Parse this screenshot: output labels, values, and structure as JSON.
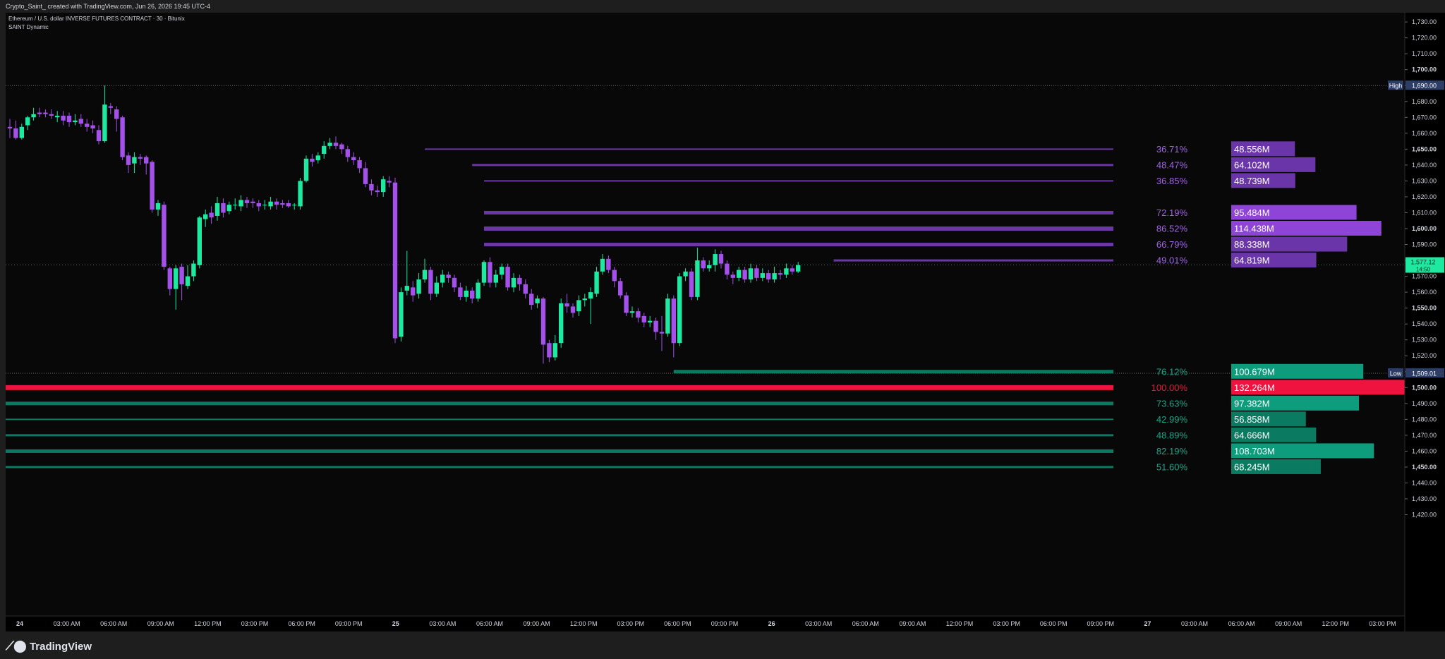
{
  "header": {
    "credit": "Crypto_Saint_ created with TradingView.com, Jun 26, 2026 19:45 UTC-4"
  },
  "legend": {
    "symbol": "Ethereum / U.S. dollar INVERSE FUTURES CONTRACT · 30 · Bitunix",
    "indicator": "SAINT Dynamic"
  },
  "footer": {
    "brand": "TradingView"
  },
  "chart_data": {
    "type": "candlestick",
    "y_range": [
      1410,
      1770
    ],
    "y_ticks": [
      1420,
      1430,
      1440,
      1450,
      1460,
      1470,
      1480,
      1490,
      1500,
      1510,
      1520,
      1530,
      1540,
      1550,
      1560,
      1570,
      1580,
      1590,
      1600,
      1610,
      1620,
      1630,
      1640,
      1650,
      1660,
      1670,
      1680,
      1690,
      1700,
      1710,
      1720,
      1730,
      1740,
      1750,
      1760
    ],
    "major_ticks": [
      1450,
      1500,
      1550,
      1600,
      1650,
      1700,
      1750
    ],
    "x_labels": [
      "24",
      "03:00 AM",
      "06:00 AM",
      "09:00 AM",
      "12:00 PM",
      "03:00 PM",
      "06:00 PM",
      "09:00 PM",
      "25",
      "03:00 AM",
      "06:00 AM",
      "09:00 AM",
      "12:00 PM",
      "03:00 PM",
      "06:00 PM",
      "09:00 PM",
      "26",
      "03:00 AM",
      "06:00 AM",
      "09:00 AM",
      "12:00 PM",
      "03:00 PM",
      "06:00 PM",
      "09:00 PM",
      "27",
      "03:00 AM",
      "06:00 AM",
      "09:00 AM",
      "12:00 PM",
      "03:00 PM"
    ],
    "x_label_bold": [
      "24",
      "25",
      "26",
      "27"
    ],
    "colors": {
      "up": "#1de9a0",
      "down": "#a451ec",
      "high_low_line": "#6a6a6a"
    },
    "candles": [
      [
        1664,
        1663,
        1669,
        1657
      ],
      [
        1663,
        1657,
        1668,
        1656
      ],
      [
        1657,
        1664,
        1666,
        1656
      ],
      [
        1665,
        1670,
        1671,
        1662
      ],
      [
        1670,
        1672,
        1676,
        1668
      ],
      [
        1673,
        1672,
        1676,
        1670
      ],
      [
        1673,
        1672,
        1675,
        1670
      ],
      [
        1672,
        1671,
        1675,
        1669
      ],
      [
        1670,
        1671,
        1674,
        1667
      ],
      [
        1671,
        1668,
        1674,
        1665
      ],
      [
        1671,
        1667,
        1673,
        1664
      ],
      [
        1667,
        1668,
        1672,
        1665
      ],
      [
        1669,
        1666,
        1672,
        1664
      ],
      [
        1666,
        1664,
        1669,
        1661
      ],
      [
        1665,
        1663,
        1668,
        1660
      ],
      [
        1662,
        1655,
        1665,
        1653
      ],
      [
        1655,
        1678,
        1690,
        1654
      ],
      [
        1677,
        1676,
        1679,
        1672
      ],
      [
        1675,
        1669,
        1677,
        1661
      ],
      [
        1670,
        1645,
        1671,
        1643
      ],
      [
        1646,
        1640,
        1648,
        1635
      ],
      [
        1641,
        1645,
        1648,
        1635
      ],
      [
        1645,
        1644,
        1647,
        1640
      ],
      [
        1645,
        1641,
        1646,
        1634
      ],
      [
        1642,
        1612,
        1643,
        1610
      ],
      [
        1612,
        1616,
        1618,
        1608
      ],
      [
        1615,
        1576,
        1617,
        1574
      ],
      [
        1575,
        1562,
        1576,
        1558
      ],
      [
        1562,
        1575,
        1577,
        1549
      ],
      [
        1576,
        1565,
        1578,
        1555
      ],
      [
        1564,
        1570,
        1577,
        1562
      ],
      [
        1570,
        1578,
        1580,
        1567
      ],
      [
        1577,
        1607,
        1608,
        1575
      ],
      [
        1606,
        1609,
        1612,
        1601
      ],
      [
        1610,
        1607,
        1614,
        1603
      ],
      [
        1608,
        1616,
        1620,
        1605
      ],
      [
        1616,
        1610,
        1619,
        1607
      ],
      [
        1611,
        1615,
        1617,
        1609
      ],
      [
        1615,
        1615,
        1619,
        1612
      ],
      [
        1614,
        1618,
        1621,
        1611
      ],
      [
        1618,
        1616,
        1620,
        1613
      ],
      [
        1617,
        1616,
        1619,
        1613
      ],
      [
        1616,
        1614,
        1618,
        1611
      ],
      [
        1615,
        1615,
        1618,
        1612
      ],
      [
        1614,
        1617,
        1620,
        1612
      ],
      [
        1617,
        1615,
        1619,
        1612
      ],
      [
        1616,
        1615,
        1618,
        1613
      ],
      [
        1616,
        1614,
        1618,
        1613
      ],
      [
        1615,
        1615,
        1616,
        1612
      ],
      [
        1614,
        1630,
        1632,
        1612
      ],
      [
        1630,
        1644,
        1646,
        1629
      ],
      [
        1644,
        1642,
        1647,
        1639
      ],
      [
        1643,
        1646,
        1648,
        1641
      ],
      [
        1647,
        1652,
        1655,
        1644
      ],
      [
        1652,
        1654,
        1657,
        1650
      ],
      [
        1654,
        1652,
        1658,
        1650
      ],
      [
        1653,
        1650,
        1654,
        1647
      ],
      [
        1650,
        1645,
        1652,
        1642
      ],
      [
        1645,
        1643,
        1648,
        1640
      ],
      [
        1643,
        1638,
        1645,
        1635
      ],
      [
        1638,
        1628,
        1642,
        1626
      ],
      [
        1628,
        1624,
        1631,
        1621
      ],
      [
        1624,
        1623,
        1627,
        1620
      ],
      [
        1623,
        1631,
        1633,
        1620
      ],
      [
        1630,
        1629,
        1633,
        1626
      ],
      [
        1629,
        1531,
        1632,
        1528
      ],
      [
        1532,
        1560,
        1563,
        1529
      ],
      [
        1561,
        1564,
        1586,
        1558
      ],
      [
        1563,
        1558,
        1567,
        1554
      ],
      [
        1559,
        1568,
        1572,
        1556
      ],
      [
        1568,
        1574,
        1581,
        1566
      ],
      [
        1574,
        1559,
        1576,
        1555
      ],
      [
        1559,
        1566,
        1570,
        1557
      ],
      [
        1566,
        1571,
        1574,
        1563
      ],
      [
        1571,
        1569,
        1573,
        1566
      ],
      [
        1569,
        1563,
        1571,
        1560
      ],
      [
        1563,
        1557,
        1566,
        1555
      ],
      [
        1557,
        1561,
        1564,
        1554
      ],
      [
        1561,
        1556,
        1563,
        1553
      ],
      [
        1556,
        1566,
        1568,
        1554
      ],
      [
        1566,
        1579,
        1580,
        1564
      ],
      [
        1579,
        1566,
        1582,
        1563
      ],
      [
        1566,
        1571,
        1574,
        1563
      ],
      [
        1571,
        1576,
        1578,
        1568
      ],
      [
        1576,
        1563,
        1578,
        1561
      ],
      [
        1563,
        1569,
        1572,
        1560
      ],
      [
        1569,
        1565,
        1571,
        1561
      ],
      [
        1565,
        1559,
        1568,
        1556
      ],
      [
        1559,
        1552,
        1562,
        1549
      ],
      [
        1553,
        1556,
        1558,
        1550
      ],
      [
        1556,
        1527,
        1557,
        1515
      ],
      [
        1528,
        1519,
        1530,
        1516
      ],
      [
        1519,
        1528,
        1533,
        1517
      ],
      [
        1528,
        1553,
        1556,
        1525
      ],
      [
        1553,
        1551,
        1559,
        1547
      ],
      [
        1551,
        1547,
        1553,
        1544
      ],
      [
        1548,
        1555,
        1558,
        1545
      ],
      [
        1555,
        1556,
        1559,
        1551
      ],
      [
        1556,
        1560,
        1563,
        1540
      ],
      [
        1559,
        1573,
        1576,
        1557
      ],
      [
        1573,
        1581,
        1584,
        1571
      ],
      [
        1581,
        1574,
        1583,
        1572
      ],
      [
        1574,
        1567,
        1576,
        1563
      ],
      [
        1567,
        1558,
        1569,
        1556
      ],
      [
        1558,
        1547,
        1560,
        1545
      ],
      [
        1547,
        1548,
        1551,
        1544
      ],
      [
        1548,
        1544,
        1550,
        1541
      ],
      [
        1545,
        1541,
        1547,
        1538
      ],
      [
        1541,
        1542,
        1545,
        1538
      ],
      [
        1542,
        1535,
        1544,
        1530
      ],
      [
        1535,
        1534,
        1545,
        1523
      ],
      [
        1534,
        1556,
        1559,
        1532
      ],
      [
        1556,
        1528,
        1558,
        1519
      ],
      [
        1528,
        1570,
        1572,
        1526
      ],
      [
        1570,
        1573,
        1575,
        1567
      ],
      [
        1573,
        1557,
        1575,
        1555
      ],
      [
        1557,
        1580,
        1588,
        1555
      ],
      [
        1580,
        1575,
        1582,
        1573
      ],
      [
        1575,
        1577,
        1580,
        1573
      ],
      [
        1577,
        1584,
        1587,
        1573
      ],
      [
        1584,
        1578,
        1586,
        1575
      ],
      [
        1578,
        1571,
        1580,
        1568
      ],
      [
        1571,
        1569,
        1573,
        1565
      ],
      [
        1569,
        1574,
        1576,
        1567
      ],
      [
        1574,
        1568,
        1576,
        1566
      ],
      [
        1568,
        1575,
        1578,
        1566
      ],
      [
        1575,
        1569,
        1577,
        1567
      ],
      [
        1569,
        1572,
        1575,
        1567
      ],
      [
        1572,
        1568,
        1574,
        1566
      ],
      [
        1568,
        1572,
        1576,
        1566
      ],
      [
        1572,
        1571,
        1574,
        1568
      ],
      [
        1571,
        1575,
        1578,
        1569
      ],
      [
        1575,
        1573,
        1577,
        1571
      ],
      [
        1573,
        1577,
        1579,
        1572
      ]
    ],
    "high_line": {
      "label": "High",
      "price": "1,690.00",
      "value": 1690
    },
    "low_line": {
      "label": "Low",
      "price": "1,509.01",
      "value": 1509.01
    },
    "last_price": {
      "price": "1,577.12",
      "countdown": "14:50",
      "value": 1577.12
    },
    "volume_levels": [
      {
        "price": 1650,
        "start": 70,
        "thickness": 2,
        "pct": "36.71%",
        "vol": "48.556M",
        "ratio": 0.367,
        "side": "supply"
      },
      {
        "price": 1640,
        "start": 78,
        "thickness": 3,
        "pct": "48.47%",
        "vol": "64.102M",
        "ratio": 0.485,
        "side": "supply"
      },
      {
        "price": 1630,
        "start": 80,
        "thickness": 2,
        "pct": "36.85%",
        "vol": "48.739M",
        "ratio": 0.369,
        "side": "supply"
      },
      {
        "price": 1610,
        "start": 80,
        "thickness": 5,
        "pct": "72.19%",
        "vol": "95.484M",
        "ratio": 0.722,
        "side": "supply"
      },
      {
        "price": 1600,
        "start": 80,
        "thickness": 6,
        "pct": "86.52%",
        "vol": "114.438M",
        "ratio": 0.865,
        "side": "supply"
      },
      {
        "price": 1590,
        "start": 80,
        "thickness": 5,
        "pct": "66.79%",
        "vol": "88.338M",
        "ratio": 0.668,
        "side": "supply"
      },
      {
        "price": 1580,
        "start": 139,
        "thickness": 3,
        "pct": "49.01%",
        "vol": "64.819M",
        "ratio": 0.49,
        "side": "supply"
      },
      {
        "price": 1510,
        "start": 112,
        "thickness": 5,
        "pct": "76.12%",
        "vol": "100.679M",
        "ratio": 0.761,
        "side": "demand"
      },
      {
        "price": 1500,
        "start": 0,
        "thickness": 7,
        "pct": "100.00%",
        "vol": "132.264M",
        "ratio": 1.0,
        "side": "poc"
      },
      {
        "price": 1490,
        "start": 0,
        "thickness": 5,
        "pct": "73.63%",
        "vol": "97.382M",
        "ratio": 0.736,
        "side": "demand"
      },
      {
        "price": 1480,
        "start": 0,
        "thickness": 2,
        "pct": "42.99%",
        "vol": "56.858M",
        "ratio": 0.43,
        "side": "demand"
      },
      {
        "price": 1470,
        "start": 0,
        "thickness": 3,
        "pct": "48.89%",
        "vol": "64.666M",
        "ratio": 0.489,
        "side": "demand"
      },
      {
        "price": 1460,
        "start": 0,
        "thickness": 5,
        "pct": "82.19%",
        "vol": "108.703M",
        "ratio": 0.822,
        "side": "demand"
      },
      {
        "price": 1450,
        "start": 0,
        "thickness": 3,
        "pct": "51.60%",
        "vol": "68.245M",
        "ratio": 0.516,
        "side": "demand"
      }
    ]
  }
}
